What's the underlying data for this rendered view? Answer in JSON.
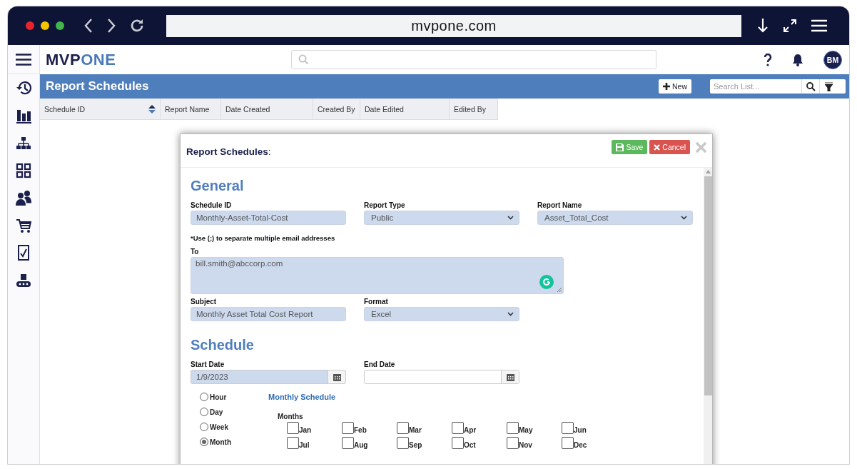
{
  "browser": {
    "url": "mvpone.com"
  },
  "app": {
    "logo": {
      "dark": "MVP",
      "light": "ONE"
    },
    "avatar": "BM"
  },
  "sidebar": {
    "items": [
      {
        "kind": "history"
      },
      {
        "kind": "chart"
      },
      {
        "kind": "hierarchy"
      },
      {
        "kind": "grid"
      },
      {
        "kind": "people"
      },
      {
        "kind": "cart"
      },
      {
        "kind": "checklist"
      },
      {
        "kind": "conveyor"
      }
    ]
  },
  "page": {
    "title": "Report Schedules",
    "new_button": "New",
    "search": {
      "placeholder": "Search List..."
    },
    "columns": [
      {
        "label": "Schedule ID",
        "sorted": true
      },
      {
        "label": "Report Name",
        "sorted": false
      },
      {
        "label": "Date Created",
        "sorted": false
      },
      {
        "label": "Created By",
        "sorted": false
      },
      {
        "label": "Date Edited",
        "sorted": false
      },
      {
        "label": "Edited By",
        "sorted": false
      }
    ]
  },
  "modal": {
    "title": "**Report Schedules**:",
    "save": "Save",
    "cancel": "Cancel",
    "general": {
      "heading": "General",
      "row1": [
        {
          "kind": "text",
          "label": "Schedule ID",
          "value": "Monthly-Asset-Total-Cost"
        },
        {
          "kind": "select",
          "label": "Report Type",
          "value": "Public"
        },
        {
          "kind": "select",
          "label": "Report Name",
          "value": "Asset_Total_Cost"
        }
      ],
      "note": "*Use (;) to separate multiple email addresses",
      "to": {
        "label": "To",
        "value": "bill.smith@abccorp.com"
      },
      "row2": [
        {
          "kind": "text",
          "label": "Subject",
          "value": "Monthly Asset Total Cost Report"
        },
        {
          "kind": "select",
          "label": "Format",
          "value": "Excel"
        }
      ]
    },
    "schedule": {
      "heading": "Schedule",
      "dates": [
        {
          "kind": "date",
          "label": "Start Date",
          "value": "1/9/2023"
        },
        {
          "kind": "date",
          "label": "End Date"
        }
      ],
      "frequency": [
        {
          "label": "Hour",
          "selected": false
        },
        {
          "label": "Day",
          "selected": false
        },
        {
          "label": "Week",
          "selected": false
        },
        {
          "label": "Month",
          "selected": true
        }
      ],
      "monthly_title": "Monthly Schedule",
      "months_label": "Months",
      "months": [
        {
          "label": "Jan",
          "checked": false
        },
        {
          "label": "Feb",
          "checked": false
        },
        {
          "label": "Mar",
          "checked": false
        },
        {
          "label": "Apr",
          "checked": false
        },
        {
          "label": "May",
          "checked": false
        },
        {
          "label": "Jun",
          "checked": false
        },
        {
          "label": "Jul",
          "checked": false
        },
        {
          "label": "Aug",
          "checked": false
        },
        {
          "label": "Sep",
          "checked": false
        },
        {
          "label": "Oct",
          "checked": false
        },
        {
          "label": "Nov",
          "checked": false
        },
        {
          "label": "Dec",
          "checked": false
        }
      ]
    }
  }
}
